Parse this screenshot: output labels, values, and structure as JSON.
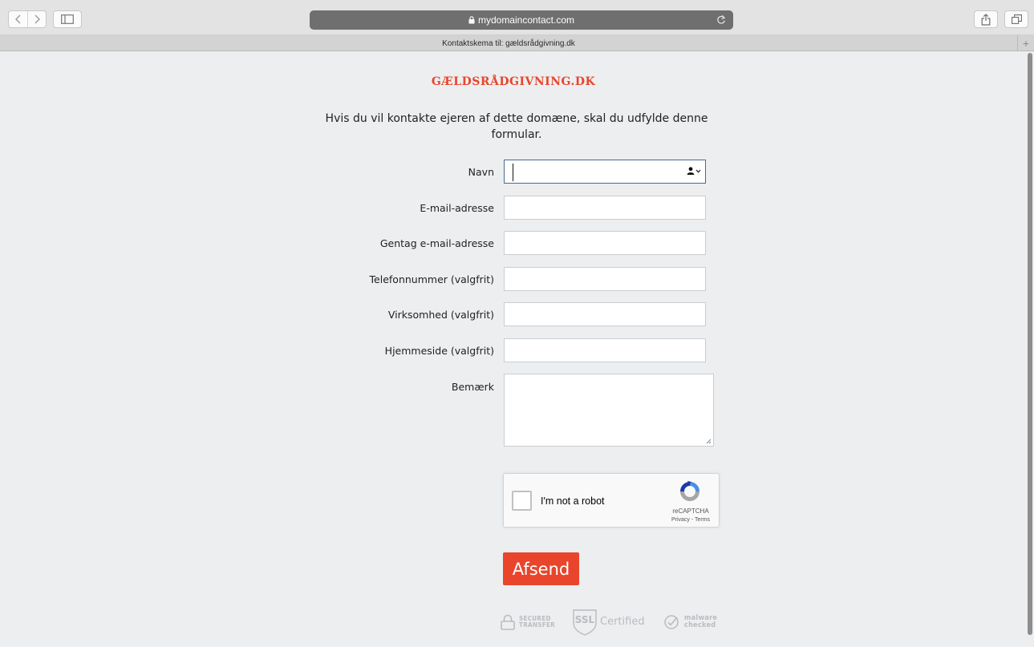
{
  "browser": {
    "url": "mydomaincontact.com",
    "tab_title": "Kontaktskema til: gældsrådgivning.dk",
    "new_tab": "+"
  },
  "page": {
    "site_title": "GÆLDSRÅDGIVNING.DK",
    "intro": "Hvis du vil kontakte ejeren af dette domæne, skal du udfylde denne formular.",
    "fields": [
      {
        "label": "Navn",
        "value": ""
      },
      {
        "label": "E-mail-adresse",
        "value": ""
      },
      {
        "label": "Gentag e-mail-adresse",
        "value": ""
      },
      {
        "label": "Telefonnummer (valgfrit)",
        "value": ""
      },
      {
        "label": "Virksomhed (valgfrit)",
        "value": ""
      },
      {
        "label": "Hjemmeside (valgfrit)",
        "value": ""
      }
    ],
    "remark_label": "Bemærk",
    "remark_value": "",
    "captcha": {
      "label": "I'm not a robot",
      "brand": "reCAPTCHA",
      "terms": "Privacy - Terms"
    },
    "submit_label": "Afsend",
    "badges": {
      "secured_line1": "SECURED",
      "secured_line2": "TRANSFER",
      "ssl_label": "SSL",
      "ssl_text": "Certified",
      "malware_line1": "malware",
      "malware_line2": "checked"
    }
  },
  "colors": {
    "accent": "#e8452c",
    "page_bg": "#eceef0",
    "badge_gray": "#b9bcc0"
  }
}
